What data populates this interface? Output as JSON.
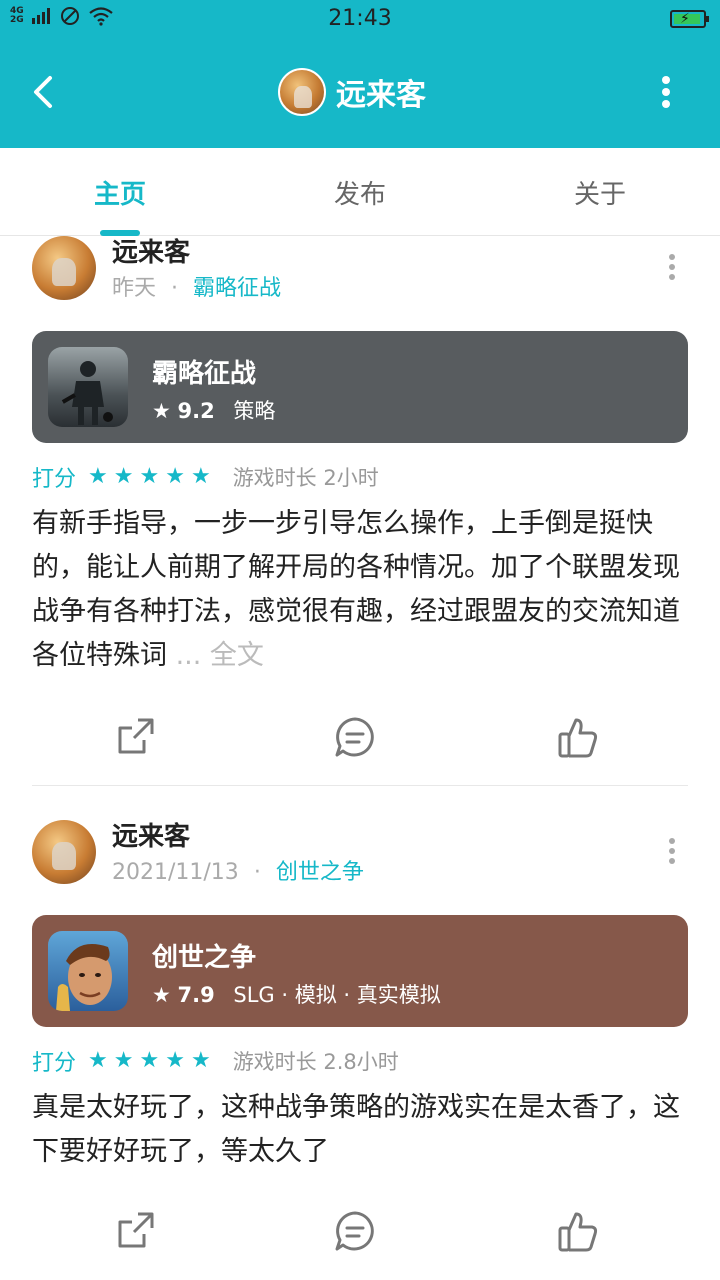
{
  "status_bar": {
    "network": "4G\n2G",
    "time": "21:43"
  },
  "header": {
    "title": "远来客"
  },
  "tabs": [
    {
      "label": "主页"
    },
    {
      "label": "发布"
    },
    {
      "label": "关于"
    }
  ],
  "posts": [
    {
      "user": "远来客",
      "time": "昨天",
      "separator": "·",
      "game_link": "霸略征战",
      "game": {
        "name": "霸略征战",
        "rating": "9.2",
        "tags": "策略",
        "card_color": "#585c5f"
      },
      "rate_label": "打分",
      "stars": 5,
      "playtime": "游戏时长 2小时",
      "review": "有新手指导，一步一步引导怎么操作，上手倒是挺快的，能让人前期了解开局的各种情况。加了个联盟发现战争有各种打法，感觉很有趣，经过跟盟友的交流知道各位特殊词",
      "more": "... 全文"
    },
    {
      "user": "远来客",
      "time": "2021/11/13",
      "separator": "·",
      "game_link": "创世之争",
      "game": {
        "name": "创世之争",
        "rating": "7.9",
        "tags": "SLG · 模拟 · 真实模拟",
        "card_color": "#86584a"
      },
      "rate_label": "打分",
      "stars": 5,
      "playtime": "游戏时长 2.8小时",
      "review": "真是太好玩了，这种战争策略的游戏实在是太香了，这下要好好玩了，等太久了"
    }
  ],
  "icons": {
    "back": "chevron-left-icon",
    "more": "more-vertical-icon",
    "share": "share-icon",
    "comment": "comment-icon",
    "like": "thumbs-up-icon"
  },
  "colors": {
    "accent": "#16b8c8"
  }
}
